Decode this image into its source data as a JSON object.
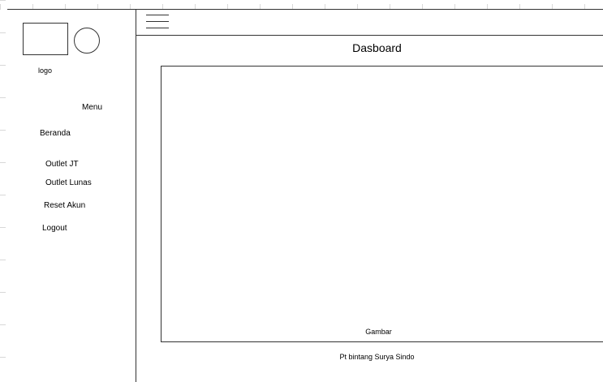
{
  "sidebar": {
    "logo_label": "logo",
    "menu_title": "Menu",
    "items": [
      {
        "label": "Beranda"
      },
      {
        "label": "Outlet JT"
      },
      {
        "label": "Outlet Lunas"
      },
      {
        "label": "Reset Akun"
      },
      {
        "label": "Logout"
      }
    ]
  },
  "header": {
    "menu_icon": "hamburger-menu-icon"
  },
  "main": {
    "title": "Dasboard",
    "image_label": "Gambar",
    "footer": "Pt bintang Surya Sindo"
  }
}
